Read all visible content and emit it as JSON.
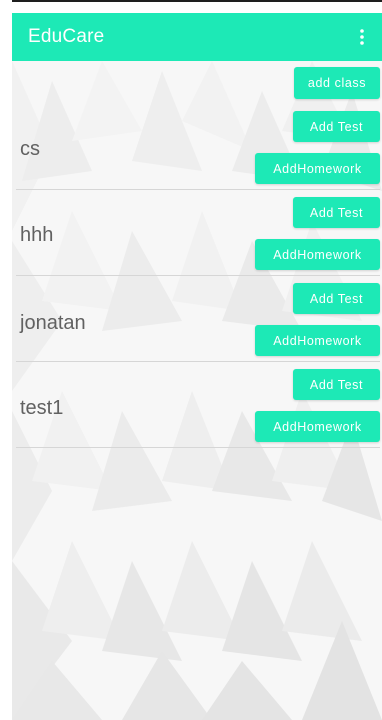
{
  "app": {
    "title": "EduCare",
    "menu_icon": "more-vert-icon"
  },
  "colors": {
    "accent": "#1de9b6",
    "text": "#616161"
  },
  "toolbar": {
    "add_class_label": "add class"
  },
  "classes": [
    {
      "name": "cs",
      "add_test_label": "Add Test",
      "add_homework_label": "AddHomework"
    },
    {
      "name": "hhh",
      "add_test_label": "Add Test",
      "add_homework_label": "AddHomework"
    },
    {
      "name": "jonatan",
      "add_test_label": "Add Test",
      "add_homework_label": "AddHomework"
    },
    {
      "name": "test1",
      "add_test_label": "Add Test",
      "add_homework_label": "AddHomework"
    }
  ]
}
